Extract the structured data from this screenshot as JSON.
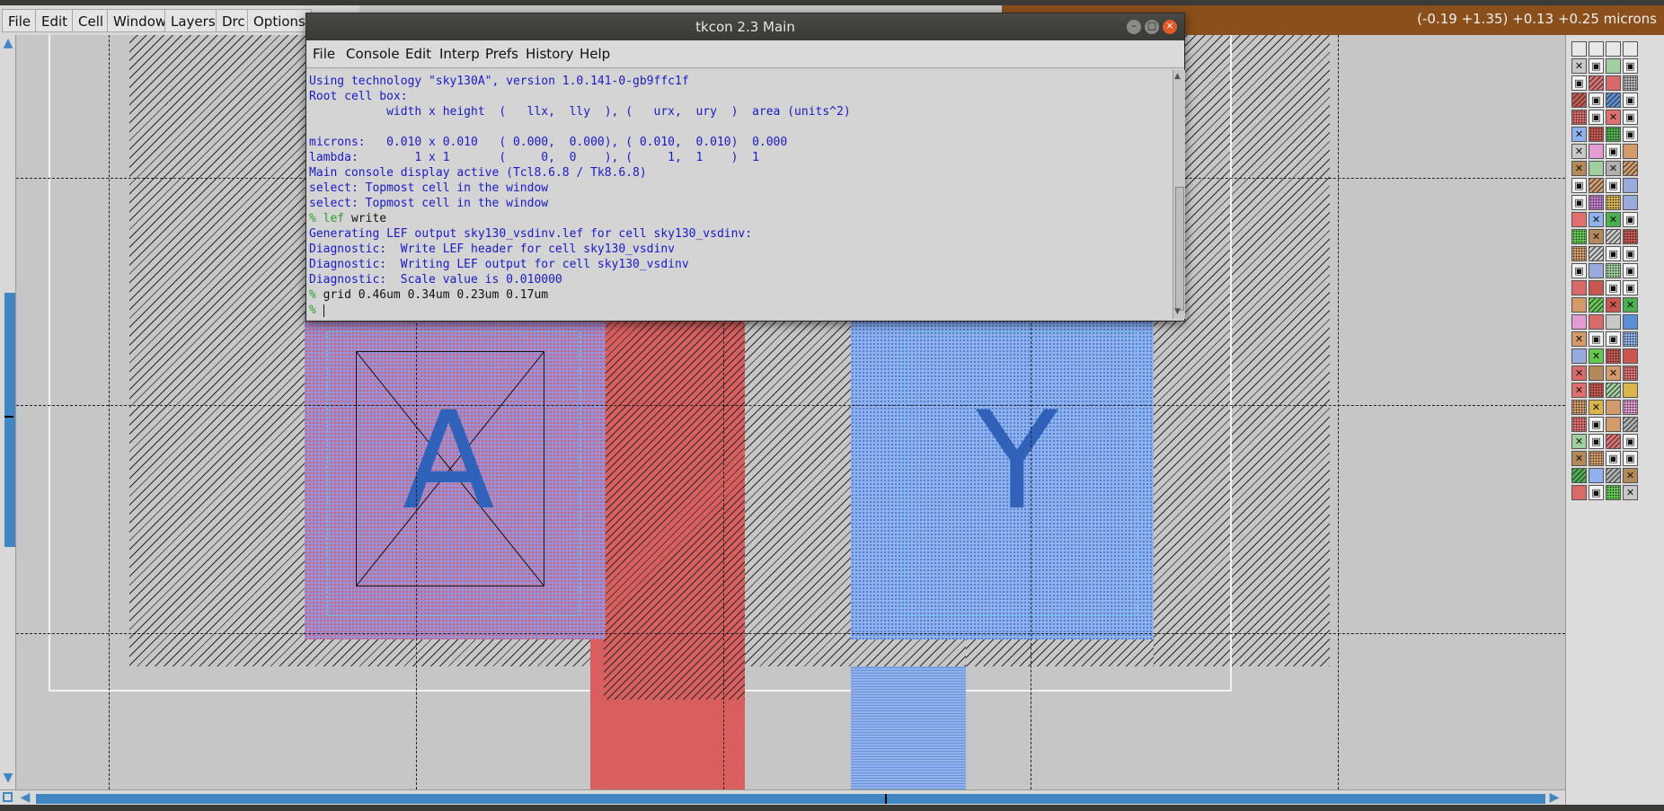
{
  "magic_menu": {
    "items": [
      "File",
      "Edit",
      "Cell",
      "Window",
      "Layers",
      "Drc",
      "Options"
    ]
  },
  "status": {
    "coordinates": "(-0.19 +1.35) +0.13 +0.25 microns"
  },
  "canvas": {
    "label_a": "A",
    "label_y": "Y"
  },
  "tkcon": {
    "title": "tkcon 2.3 Main",
    "menu": [
      "File",
      "Console",
      "Edit",
      "Interp",
      "Prefs",
      "History",
      "Help"
    ],
    "lines": [
      "Using technology \"sky130A\", version 1.0.141-0-gb9ffc1f",
      "Root cell box:",
      "           width x height  (   llx,  lly  ), (   urx,  ury  )  area (units^2)",
      "",
      "microns:   0.010 x 0.010   ( 0.000,  0.000), ( 0.010,  0.010)  0.000",
      "lambda:        1 x 1       (     0,  0    ), (     1,  1    )  1",
      "Main console display active (Tcl8.6.8 / Tk8.6.8)",
      "select: Topmost cell in the window",
      "select: Topmost cell in the window"
    ],
    "cmd1_prompt": "%",
    "cmd1_kw": "lef",
    "cmd1_rest": " write",
    "lines2": [
      "Generating LEF output sky130_vsdinv.lef for cell sky130_vsdinv:",
      "Diagnostic:  Write LEF header for cell sky130_vsdinv",
      "Diagnostic:  Writing LEF output for cell sky130_vsdinv",
      "Diagnostic:  Scale value is 0.010000"
    ],
    "cmd2_prompt": "%",
    "cmd2": " grid 0.46um 0.34um 0.23um 0.17um",
    "cmd3_prompt": "%"
  },
  "colors": {
    "metal_red": "#d95f5f",
    "local_blue": "#8fb2ec",
    "poly_purple": "#9a90d8",
    "label_blue": "#2f62b8",
    "accent_scroll": "#3f86c2"
  }
}
